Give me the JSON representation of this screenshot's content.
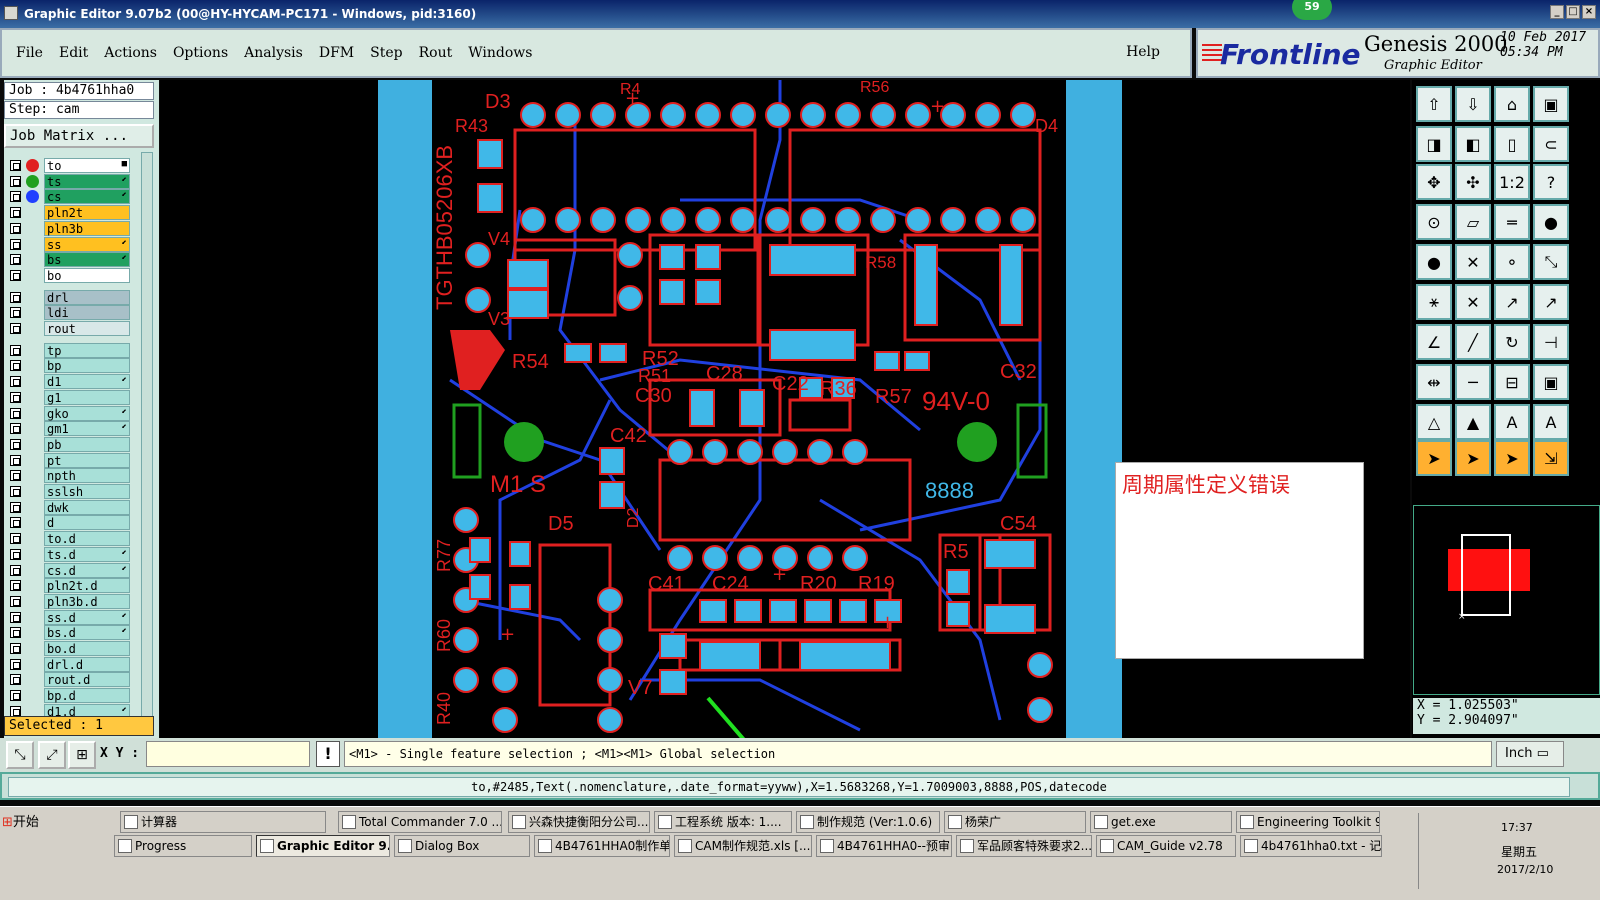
{
  "window": {
    "title": "Graphic Editor 9.07b2 (00@HY-HYCAM-PC171 - Windows, pid:3160)",
    "badge": "59"
  },
  "menu": {
    "items": [
      "File",
      "Edit",
      "Actions",
      "Options",
      "Analysis",
      "DFM",
      "Step",
      "Rout",
      "Windows"
    ],
    "help": "Help"
  },
  "brand": {
    "logo": "Frontline",
    "product": "Genesis 2000",
    "subtitle": "Graphic Editor",
    "date": "10 Feb 2017",
    "time": "05:34 PM"
  },
  "job": {
    "job_line": "Job : 4b4761hha0",
    "step_line": "Step: cam",
    "matrix_button": "Job Matrix ..."
  },
  "layers": [
    {
      "name": "to",
      "color": "#ffffff",
      "sym": "#e02020",
      "mark": "■"
    },
    {
      "name": "ts",
      "color": "#20a060",
      "sym": "#20a020",
      "mark": "⬋"
    },
    {
      "name": "cs",
      "color": "#20a060",
      "sym": "#2040ff",
      "mark": "⬋"
    },
    {
      "name": "pln2t",
      "color": "#ffc020",
      "sym": "",
      "mark": ""
    },
    {
      "name": "pln3b",
      "color": "#ffc020",
      "sym": "",
      "mark": ""
    },
    {
      "name": "ss",
      "color": "#ffc020",
      "sym": "",
      "mark": "⬋"
    },
    {
      "name": "bs",
      "color": "#20a060",
      "sym": "",
      "mark": "⬋"
    },
    {
      "name": "bo",
      "color": "#ffffff",
      "sym": "",
      "mark": ""
    },
    {
      "name": "drl",
      "color": "#a8c0c8",
      "sym": "",
      "mark": ""
    },
    {
      "name": "ldi",
      "color": "#a8c0c8",
      "sym": "",
      "mark": ""
    },
    {
      "name": "rout",
      "color": "#d8e8e8",
      "sym": "",
      "mark": ""
    },
    {
      "name": "tp",
      "color": "#a8e0d8",
      "sym": "",
      "mark": ""
    },
    {
      "name": "bp",
      "color": "#a8e0d8",
      "sym": "",
      "mark": ""
    },
    {
      "name": "d1",
      "color": "#a8e0d8",
      "sym": "",
      "mark": "⬋"
    },
    {
      "name": "g1",
      "color": "#a8e0d8",
      "sym": "",
      "mark": ""
    },
    {
      "name": "gko",
      "color": "#a8e0d8",
      "sym": "",
      "mark": "⬋"
    },
    {
      "name": "gm1",
      "color": "#a8e0d8",
      "sym": "",
      "mark": "⬋"
    },
    {
      "name": "pb",
      "color": "#a8e0d8",
      "sym": "",
      "mark": ""
    },
    {
      "name": "pt",
      "color": "#a8e0d8",
      "sym": "",
      "mark": ""
    },
    {
      "name": "npth",
      "color": "#a8e0d8",
      "sym": "",
      "mark": ""
    },
    {
      "name": "sslsh",
      "color": "#a8e0d8",
      "sym": "",
      "mark": ""
    },
    {
      "name": "dwk",
      "color": "#a8e0d8",
      "sym": "",
      "mark": ""
    },
    {
      "name": "d",
      "color": "#a8e0d8",
      "sym": "",
      "mark": ""
    },
    {
      "name": "to.d",
      "color": "#a8e0d8",
      "sym": "",
      "mark": ""
    },
    {
      "name": "ts.d",
      "color": "#a8e0d8",
      "sym": "",
      "mark": "⬋"
    },
    {
      "name": "cs.d",
      "color": "#a8e0d8",
      "sym": "",
      "mark": "⬋"
    },
    {
      "name": "pln2t.d",
      "color": "#a8e0d8",
      "sym": "",
      "mark": ""
    },
    {
      "name": "pln3b.d",
      "color": "#a8e0d8",
      "sym": "",
      "mark": ""
    },
    {
      "name": "ss.d",
      "color": "#a8e0d8",
      "sym": "",
      "mark": "⬋"
    },
    {
      "name": "bs.d",
      "color": "#a8e0d8",
      "sym": "",
      "mark": "⬋"
    },
    {
      "name": "bo.d",
      "color": "#a8e0d8",
      "sym": "",
      "mark": ""
    },
    {
      "name": "drl.d",
      "color": "#a8e0d8",
      "sym": "",
      "mark": ""
    },
    {
      "name": "rout.d",
      "color": "#a8e0d8",
      "sym": "",
      "mark": ""
    },
    {
      "name": "bp.d",
      "color": "#a8e0d8",
      "sym": "",
      "mark": ""
    },
    {
      "name": "d1.d",
      "color": "#a8e0d8",
      "sym": "",
      "mark": "⬋"
    }
  ],
  "selected": "Selected : 1",
  "board": {
    "silk_labels": [
      "D3",
      "R43",
      "D4",
      "V4",
      "V3",
      "R58",
      "R54",
      "R52",
      "R51",
      "C30",
      "C28",
      "C22",
      "R36",
      "R57",
      "94V-0",
      "C32",
      "C42",
      "M1 S",
      "8888",
      "D5",
      "D2",
      "C54",
      "R77",
      "R5",
      "C41",
      "C24",
      "R20",
      "R19",
      "R60",
      "R40",
      "V7",
      "TGTHB05206XB",
      "R56",
      "R4"
    ]
  },
  "popup": {
    "text": "周期属性定义错误"
  },
  "coords": {
    "x": "X = 1.025503\"",
    "y": "Y = 2.904097\""
  },
  "cmd": {
    "xy_label": "X Y :",
    "xy_value": "",
    "hint": "<M1> - Single feature selection ; <M1><M1> Global selection",
    "unit": "Inch"
  },
  "feature_line": "to,#2485,Text(.nomenclature,.date_format=yyww),X=1.5683268,Y=1.7009003,8888,POS,datecode",
  "taskbar": {
    "start": "开始",
    "row1": [
      "计算器",
      "Total Commander 7.0 ...",
      "兴森快捷衡阳分公司...",
      "工程系统  版本: 1....",
      "制作规范 (Ver:1.0.6)",
      "杨荣广",
      "get.exe",
      "Engineering Toolkit 9...."
    ],
    "row2": [
      "Progress",
      "Graphic Editor 9.07...",
      "Dialog Box",
      "4B4761HHA0制作单....",
      "CAM制作规范.xls  [...",
      "4B4761HHA0--预审...",
      "军品顾客特殊要求2...",
      "CAM_Guide v2.78",
      "4b4761hha0.txt - 记..."
    ],
    "time": "17:37",
    "day": "星期五",
    "date": "2017/2/10"
  },
  "colors": {
    "board_fill": "#000000",
    "copper_red": "#e02020",
    "pad_blue": "#40b8e8",
    "trace_blue": "#2040e0",
    "border_blue": "#40b0e0"
  }
}
